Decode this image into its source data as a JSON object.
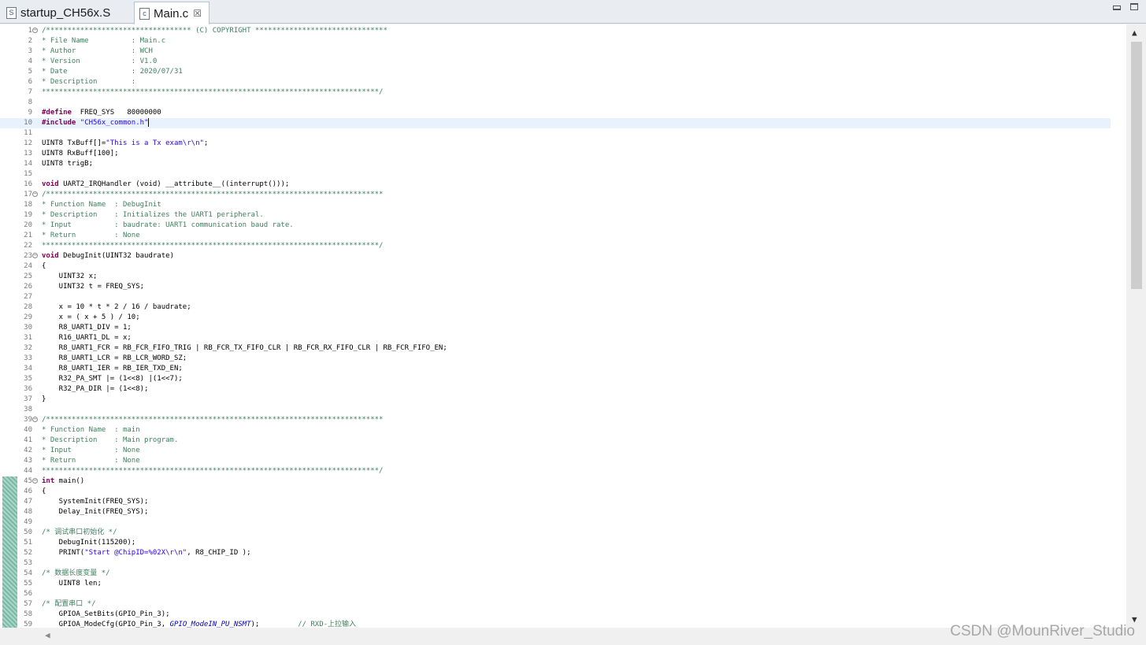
{
  "tabs": [
    {
      "label": "startup_CH56x.S",
      "icon": "asm-file-icon",
      "icon_glyph": "S"
    },
    {
      "label": "Main.c",
      "icon": "c-file-icon",
      "icon_glyph": "c",
      "close": "☒"
    }
  ],
  "window": {
    "minimize": "minimize",
    "maximize": "maximize"
  },
  "scroll": {
    "up": "▲",
    "down": "▼",
    "left": "◀",
    "position": 0.0
  },
  "watermark": "CSDN @MounRiver_Studio",
  "colors": {
    "comment": "#3f7f5f",
    "keyword": "#7f0055",
    "string": "#2a00ff",
    "current_line": "#e8f2fe",
    "change_bar": "#8fc8b6"
  },
  "editor": {
    "current_line": 10,
    "lines": [
      {
        "n": "1",
        "fold": true,
        "seg": [
          [
            "cm",
            "/********************************** (C) COPYRIGHT *******************************"
          ]
        ]
      },
      {
        "n": "2",
        "seg": [
          [
            "cm",
            "* File Name          : Main.c"
          ]
        ]
      },
      {
        "n": "3",
        "seg": [
          [
            "cm",
            "* Author             : WCH"
          ]
        ]
      },
      {
        "n": "4",
        "seg": [
          [
            "cm",
            "* Version            : V1.0"
          ]
        ]
      },
      {
        "n": "5",
        "seg": [
          [
            "cm",
            "* Date               : 2020/07/31"
          ]
        ]
      },
      {
        "n": "6",
        "seg": [
          [
            "cm",
            "* Description        :"
          ]
        ]
      },
      {
        "n": "7",
        "seg": [
          [
            "cm",
            "*******************************************************************************/"
          ]
        ]
      },
      {
        "n": "8",
        "seg": []
      },
      {
        "n": "9",
        "seg": [
          [
            "pp",
            "#define"
          ],
          [
            "nm",
            "  FREQ_SYS   80000000"
          ]
        ]
      },
      {
        "n": "10",
        "seg": [
          [
            "pp",
            "#include"
          ],
          [
            "nm",
            " "
          ],
          [
            "str",
            "\"CH56x_common.h\""
          ]
        ],
        "caret": true
      },
      {
        "n": "11",
        "seg": []
      },
      {
        "n": "12",
        "seg": [
          [
            "nm",
            "UINT8 TxBuff[]="
          ],
          [
            "str",
            "\"This is a Tx exam\\r\\n\""
          ],
          [
            "nm",
            ";"
          ]
        ]
      },
      {
        "n": "13",
        "seg": [
          [
            "nm",
            "UINT8 RxBuff[100];"
          ]
        ]
      },
      {
        "n": "14",
        "seg": [
          [
            "nm",
            "UINT8 trigB;"
          ]
        ]
      },
      {
        "n": "15",
        "seg": []
      },
      {
        "n": "16",
        "seg": [
          [
            "kw",
            "void"
          ],
          [
            "nm",
            " UART2_IRQHandler (void) __attribute__((interrupt()));"
          ]
        ]
      },
      {
        "n": "17",
        "fold": true,
        "seg": [
          [
            "cm",
            "/*******************************************************************************"
          ]
        ]
      },
      {
        "n": "18",
        "seg": [
          [
            "cm",
            "* Function Name  : DebugInit"
          ]
        ]
      },
      {
        "n": "19",
        "seg": [
          [
            "cm",
            "* Description    : Initializes the UART1 peripheral."
          ]
        ]
      },
      {
        "n": "20",
        "seg": [
          [
            "cm",
            "* Input          : baudrate: UART1 communication baud rate."
          ]
        ]
      },
      {
        "n": "21",
        "seg": [
          [
            "cm",
            "* Return         : None"
          ]
        ]
      },
      {
        "n": "22",
        "seg": [
          [
            "cm",
            "*******************************************************************************/"
          ]
        ]
      },
      {
        "n": "23",
        "fold": true,
        "seg": [
          [
            "kw",
            "void"
          ],
          [
            "nm",
            " DebugInit(UINT32 baudrate)"
          ]
        ]
      },
      {
        "n": "24",
        "seg": [
          [
            "nm",
            "{"
          ]
        ]
      },
      {
        "n": "25",
        "seg": [
          [
            "nm",
            "    UINT32 x;"
          ]
        ]
      },
      {
        "n": "26",
        "seg": [
          [
            "nm",
            "    UINT32 t = FREQ_SYS;"
          ]
        ]
      },
      {
        "n": "27",
        "seg": []
      },
      {
        "n": "28",
        "seg": [
          [
            "nm",
            "    x = 10 * t * 2 / 16 / baudrate;"
          ]
        ]
      },
      {
        "n": "29",
        "seg": [
          [
            "nm",
            "    x = ( x + 5 ) / 10;"
          ]
        ]
      },
      {
        "n": "30",
        "seg": [
          [
            "nm",
            "    R8_UART1_DIV = 1;"
          ]
        ]
      },
      {
        "n": "31",
        "seg": [
          [
            "nm",
            "    R16_UART1_DL = x;"
          ]
        ]
      },
      {
        "n": "32",
        "seg": [
          [
            "nm",
            "    R8_UART1_FCR = RB_FCR_FIFO_TRIG | RB_FCR_TX_FIFO_CLR | RB_FCR_RX_FIFO_CLR | RB_FCR_FIFO_EN;"
          ]
        ]
      },
      {
        "n": "33",
        "seg": [
          [
            "nm",
            "    R8_UART1_LCR = RB_LCR_WORD_SZ;"
          ]
        ]
      },
      {
        "n": "34",
        "seg": [
          [
            "nm",
            "    R8_UART1_IER = RB_IER_TXD_EN;"
          ]
        ]
      },
      {
        "n": "35",
        "seg": [
          [
            "nm",
            "    R32_PA_SMT |= (1<<8) |(1<<7);"
          ]
        ]
      },
      {
        "n": "36",
        "seg": [
          [
            "nm",
            "    R32_PA_DIR |= (1<<8);"
          ]
        ]
      },
      {
        "n": "37",
        "seg": [
          [
            "nm",
            "}"
          ]
        ]
      },
      {
        "n": "38",
        "seg": []
      },
      {
        "n": "39",
        "fold": true,
        "seg": [
          [
            "cm",
            "/*******************************************************************************"
          ]
        ]
      },
      {
        "n": "40",
        "seg": [
          [
            "cm",
            "* Function Name  : main"
          ]
        ]
      },
      {
        "n": "41",
        "seg": [
          [
            "cm",
            "* Description    : Main program."
          ]
        ]
      },
      {
        "n": "42",
        "seg": [
          [
            "cm",
            "* Input          : None"
          ]
        ]
      },
      {
        "n": "43",
        "seg": [
          [
            "cm",
            "* Return         : None"
          ]
        ]
      },
      {
        "n": "44",
        "seg": [
          [
            "cm",
            "*******************************************************************************/"
          ]
        ]
      },
      {
        "n": "45",
        "fold": true,
        "chg": true,
        "seg": [
          [
            "kw",
            "int"
          ],
          [
            "nm",
            " main()"
          ]
        ]
      },
      {
        "n": "46",
        "chg": true,
        "seg": [
          [
            "nm",
            "{"
          ]
        ]
      },
      {
        "n": "47",
        "chg": true,
        "seg": [
          [
            "nm",
            "    SystemInit(FREQ_SYS);"
          ]
        ]
      },
      {
        "n": "48",
        "chg": true,
        "seg": [
          [
            "nm",
            "    Delay_Init(FREQ_SYS);"
          ]
        ]
      },
      {
        "n": "49",
        "chg": true,
        "seg": []
      },
      {
        "n": "50",
        "chg": true,
        "seg": [
          [
            "cm",
            "/* 调试串口初始化 */"
          ]
        ]
      },
      {
        "n": "51",
        "chg": true,
        "seg": [
          [
            "nm",
            "    DebugInit(115200);"
          ]
        ]
      },
      {
        "n": "52",
        "chg": true,
        "seg": [
          [
            "nm",
            "    PRINT("
          ],
          [
            "str",
            "\"Start @ChipID=%02X\\r\\n\""
          ],
          [
            "nm",
            ", R8_CHIP_ID );"
          ]
        ]
      },
      {
        "n": "53",
        "chg": true,
        "seg": []
      },
      {
        "n": "54",
        "chg": true,
        "seg": [
          [
            "cm",
            "/* 数据长度变量 */"
          ]
        ]
      },
      {
        "n": "55",
        "chg": true,
        "seg": [
          [
            "nm",
            "    UINT8 len;"
          ]
        ]
      },
      {
        "n": "56",
        "chg": true,
        "seg": []
      },
      {
        "n": "57",
        "chg": true,
        "seg": [
          [
            "cm",
            "/* 配置串口 */"
          ]
        ]
      },
      {
        "n": "58",
        "chg": true,
        "seg": [
          [
            "nm",
            "    GPIOA_SetBits(GPIO_Pin_3);"
          ]
        ]
      },
      {
        "n": "59",
        "chg": true,
        "seg": [
          [
            "nm",
            "    GPIOA_ModeCfg(GPIO_Pin_3, "
          ],
          [
            "it",
            "GPIO_ModeIN_PU_NSMT"
          ],
          [
            "nm",
            ");         "
          ],
          [
            "cm",
            "// RXD-上拉输入"
          ]
        ]
      }
    ]
  }
}
